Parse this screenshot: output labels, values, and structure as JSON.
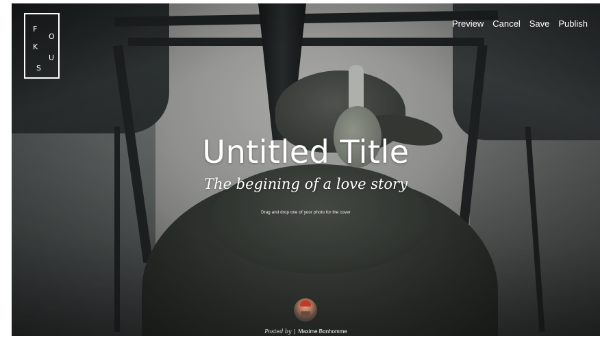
{
  "logo": {
    "letters": [
      "F",
      "O",
      "K",
      "U",
      "S"
    ]
  },
  "nav": {
    "preview_label": "Preview",
    "cancel_label": "Cancel",
    "save_label": "Save",
    "publish_label": "Publish"
  },
  "story": {
    "title": "Untitled Title",
    "subtitle": "The begining of a love story",
    "cover_hint": "Drag and drop one of your photo for the cover"
  },
  "author": {
    "posted_by": "Posted by",
    "separator": "|",
    "name": "Maxime Bonhomme"
  },
  "colors": {
    "text": "#ffffff",
    "page_background": "#ffffff"
  },
  "icons": {
    "avatar": "author-avatar"
  }
}
